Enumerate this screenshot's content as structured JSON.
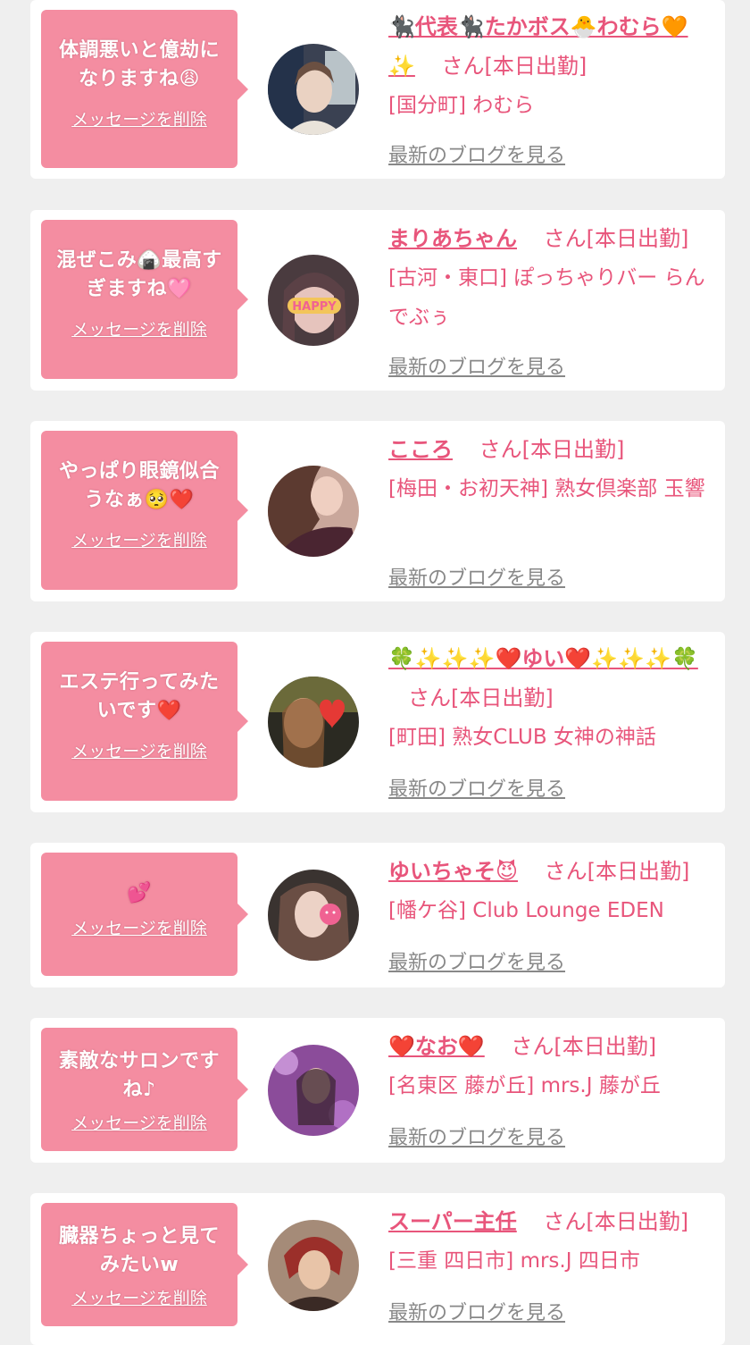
{
  "delete_label": "メッセージを削除",
  "blog_label": "最新のブログを見る",
  "colors": {
    "bubble": "#f48da1",
    "accent": "#e8557b",
    "muted": "#888888"
  },
  "items": [
    {
      "message": "体調悪いと億劫になりますね😩",
      "name": "🐈‍⬛代表🐈‍⬛たかボス🐣わむら🧡✨",
      "suffix": "さん[本日出勤]",
      "shop": "[国分町] わむら"
    },
    {
      "message": "混ぜこみ🍙最高すぎますね🩷",
      "name": "まりあちゃん",
      "suffix": "さん[本日出勤]",
      "shop": "[古河・東口] ぽっちゃりバー らんでぶぅ"
    },
    {
      "message": "やっぱり眼鏡似合うなぁ🥺❤️",
      "name": "こころ",
      "suffix": "さん[本日出勤]",
      "shop": "[梅田・お初天神] 熟女倶楽部 玉響"
    },
    {
      "message": "エステ行ってみたいです❤️",
      "name": "🍀✨✨✨❤️ゆい❤️✨✨✨🍀",
      "suffix": "さん[本日出勤]",
      "shop": "[町田] 熟女CLUB 女神の神話"
    },
    {
      "message": "💕",
      "name": "ゆいちゃそ😈",
      "suffix": "さん[本日出勤]",
      "shop": "[幡ケ谷] Club Lounge EDEN"
    },
    {
      "message": "素敵なサロンですね♪",
      "name": "❤️なお❤️",
      "suffix": "さん[本日出勤]",
      "shop": "[名東区 藤が丘] mrs.J 藤が丘"
    },
    {
      "message": "臓器ちょっと見てみたいw",
      "name": "スーパー主任",
      "suffix": "さん[本日出勤]",
      "shop": "[三重 四日市] mrs.J 四日市"
    }
  ]
}
